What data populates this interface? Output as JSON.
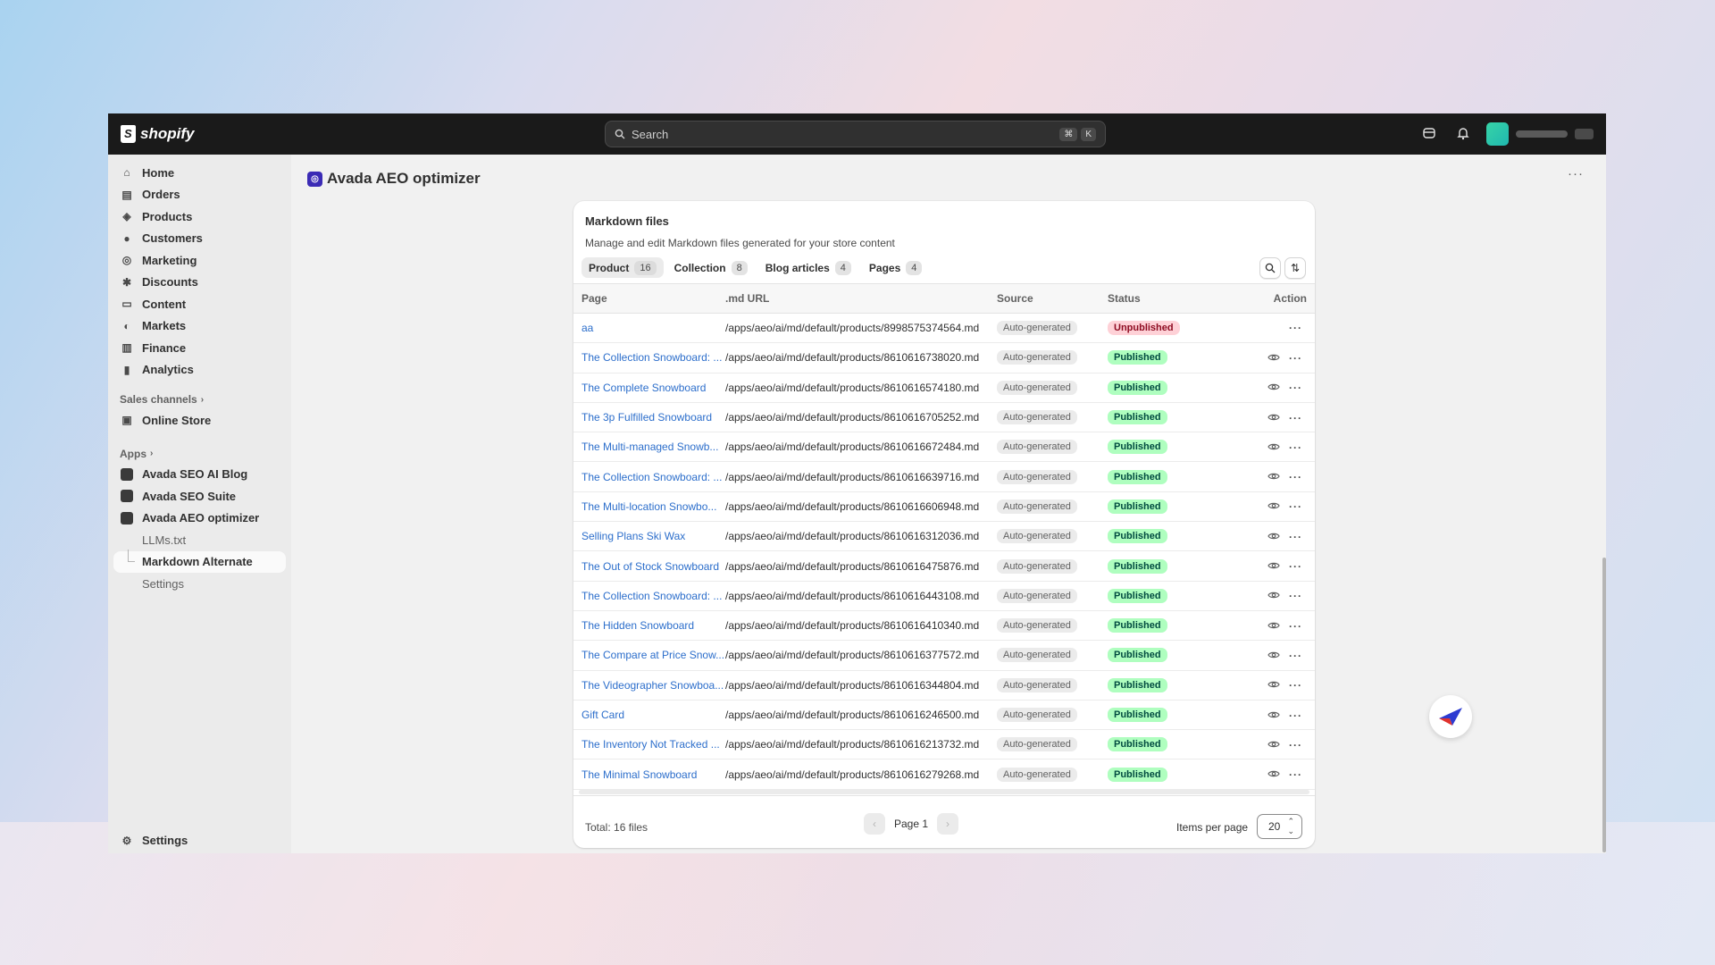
{
  "topbar": {
    "brand": "shopify",
    "search_placeholder": "Search",
    "shortcut_keys": [
      "⌘",
      "K"
    ]
  },
  "sidebar": {
    "nav": [
      {
        "label": "Home",
        "icon": "home-icon"
      },
      {
        "label": "Orders",
        "icon": "orders-icon"
      },
      {
        "label": "Products",
        "icon": "tag-icon"
      },
      {
        "label": "Customers",
        "icon": "person-icon"
      },
      {
        "label": "Marketing",
        "icon": "target-icon"
      },
      {
        "label": "Discounts",
        "icon": "discount-icon"
      },
      {
        "label": "Content",
        "icon": "content-icon"
      },
      {
        "label": "Markets",
        "icon": "globe-icon"
      },
      {
        "label": "Finance",
        "icon": "bank-icon"
      },
      {
        "label": "Analytics",
        "icon": "chart-icon"
      }
    ],
    "sales_channels_label": "Sales channels",
    "online_store": "Online Store",
    "apps_label": "Apps",
    "apps": [
      "Avada SEO AI Blog",
      "Avada SEO Suite",
      "Avada AEO optimizer"
    ],
    "app_subitems": [
      "LLMs.txt",
      "Markdown Alternate",
      "Settings"
    ],
    "settings": "Settings"
  },
  "page": {
    "title": "Avada AEO optimizer"
  },
  "card": {
    "title": "Markdown files",
    "description": "Manage and edit Markdown files generated for your store content",
    "tabs": [
      {
        "label": "Product",
        "count": "16"
      },
      {
        "label": "Collection",
        "count": "8"
      },
      {
        "label": "Blog articles",
        "count": "4"
      },
      {
        "label": "Pages",
        "count": "4"
      }
    ],
    "columns": {
      "page": "Page",
      "url": ".md URL",
      "source": "Source",
      "status": "Status",
      "action": "Action"
    },
    "rows": [
      {
        "page": "aa",
        "url": "/apps/aeo/ai/md/default/products/8998575374564.md",
        "source": "Auto-generated",
        "status": "Unpublished"
      },
      {
        "page": "The Collection Snowboard: ...",
        "url": "/apps/aeo/ai/md/default/products/8610616738020.md",
        "source": "Auto-generated",
        "status": "Published"
      },
      {
        "page": "The Complete Snowboard",
        "url": "/apps/aeo/ai/md/default/products/8610616574180.md",
        "source": "Auto-generated",
        "status": "Published"
      },
      {
        "page": "The 3p Fulfilled Snowboard",
        "url": "/apps/aeo/ai/md/default/products/8610616705252.md",
        "source": "Auto-generated",
        "status": "Published"
      },
      {
        "page": "The Multi-managed Snowb...",
        "url": "/apps/aeo/ai/md/default/products/8610616672484.md",
        "source": "Auto-generated",
        "status": "Published"
      },
      {
        "page": "The Collection Snowboard: ...",
        "url": "/apps/aeo/ai/md/default/products/8610616639716.md",
        "source": "Auto-generated",
        "status": "Published"
      },
      {
        "page": "The Multi-location Snowbo...",
        "url": "/apps/aeo/ai/md/default/products/8610616606948.md",
        "source": "Auto-generated",
        "status": "Published"
      },
      {
        "page": "Selling Plans Ski Wax",
        "url": "/apps/aeo/ai/md/default/products/8610616312036.md",
        "source": "Auto-generated",
        "status": "Published"
      },
      {
        "page": "The Out of Stock Snowboard",
        "url": "/apps/aeo/ai/md/default/products/8610616475876.md",
        "source": "Auto-generated",
        "status": "Published"
      },
      {
        "page": "The Collection Snowboard: ...",
        "url": "/apps/aeo/ai/md/default/products/8610616443108.md",
        "source": "Auto-generated",
        "status": "Published"
      },
      {
        "page": "The Hidden Snowboard",
        "url": "/apps/aeo/ai/md/default/products/8610616410340.md",
        "source": "Auto-generated",
        "status": "Published"
      },
      {
        "page": "The Compare at Price Snow...",
        "url": "/apps/aeo/ai/md/default/products/8610616377572.md",
        "source": "Auto-generated",
        "status": "Published"
      },
      {
        "page": "The Videographer Snowboa...",
        "url": "/apps/aeo/ai/md/default/products/8610616344804.md",
        "source": "Auto-generated",
        "status": "Published"
      },
      {
        "page": "Gift Card",
        "url": "/apps/aeo/ai/md/default/products/8610616246500.md",
        "source": "Auto-generated",
        "status": "Published"
      },
      {
        "page": "The Inventory Not Tracked ...",
        "url": "/apps/aeo/ai/md/default/products/8610616213732.md",
        "source": "Auto-generated",
        "status": "Published"
      },
      {
        "page": "The Minimal Snowboard",
        "url": "/apps/aeo/ai/md/default/products/8610616279268.md",
        "source": "Auto-generated",
        "status": "Published"
      }
    ],
    "footer": {
      "total": "Total: 16 files",
      "page_label": "Page 1",
      "items_per_page_label": "Items per page",
      "items_per_page_value": "20"
    }
  },
  "colors": {
    "link": "#2c6ecb",
    "published_bg": "#affebf",
    "unpublished_bg": "#fed1d7",
    "topbar": "#1a1a1a"
  }
}
